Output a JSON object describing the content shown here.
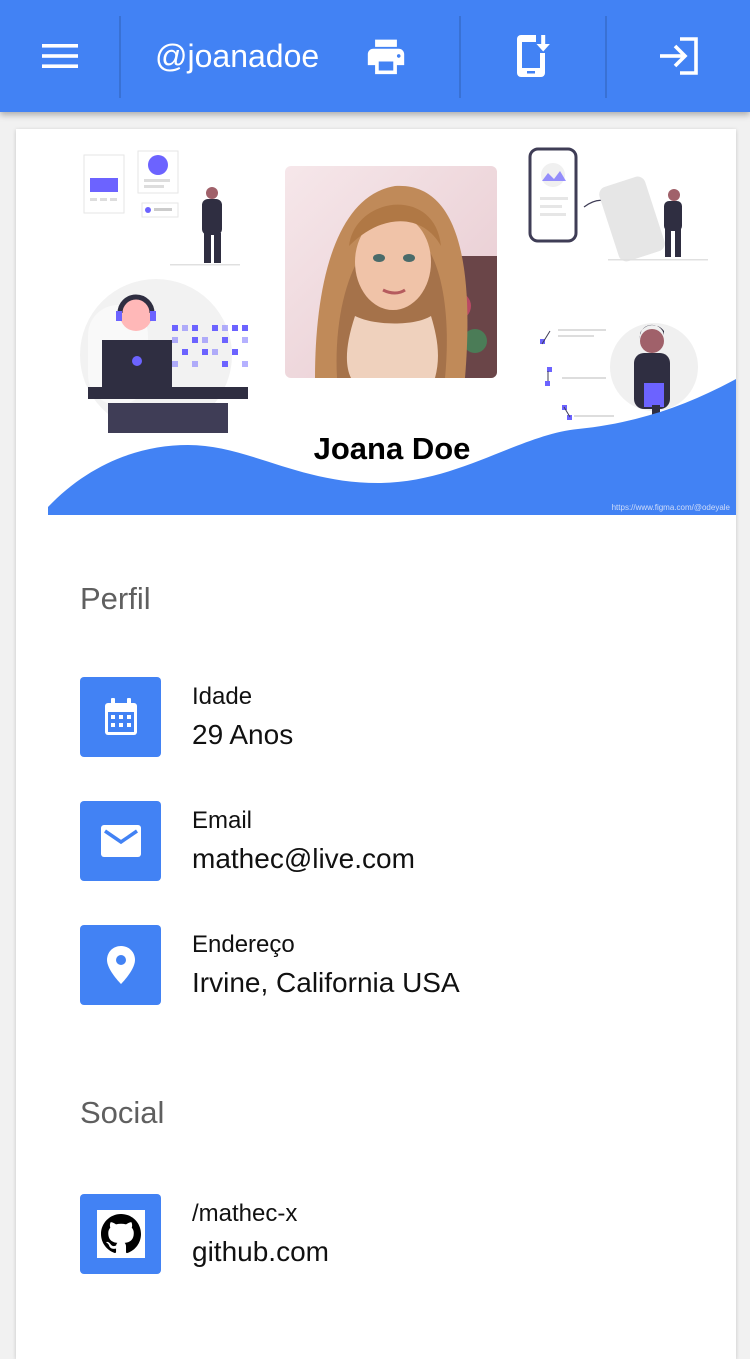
{
  "appbar": {
    "username": "@joanadoe",
    "menu_icon": "menu-icon",
    "print_icon": "print-icon",
    "install_icon": "phone-download-icon",
    "login_icon": "login-icon",
    "color": "#4282f4"
  },
  "hero": {
    "name": "Joana Doe",
    "credit": "https://www.figma.com/@odeyale"
  },
  "profile": {
    "title": "Perfil",
    "items": [
      {
        "icon": "calendar-icon",
        "label": "Idade",
        "value": "29 Anos"
      },
      {
        "icon": "email-icon",
        "label": "Email",
        "value": "mathec@live.com"
      },
      {
        "icon": "location-pin-icon",
        "label": "Endereço",
        "value": "Irvine, California USA"
      }
    ]
  },
  "social": {
    "title": "Social",
    "items": [
      {
        "icon": "github-icon",
        "label": "/mathec-x",
        "value": "github.com"
      }
    ]
  }
}
